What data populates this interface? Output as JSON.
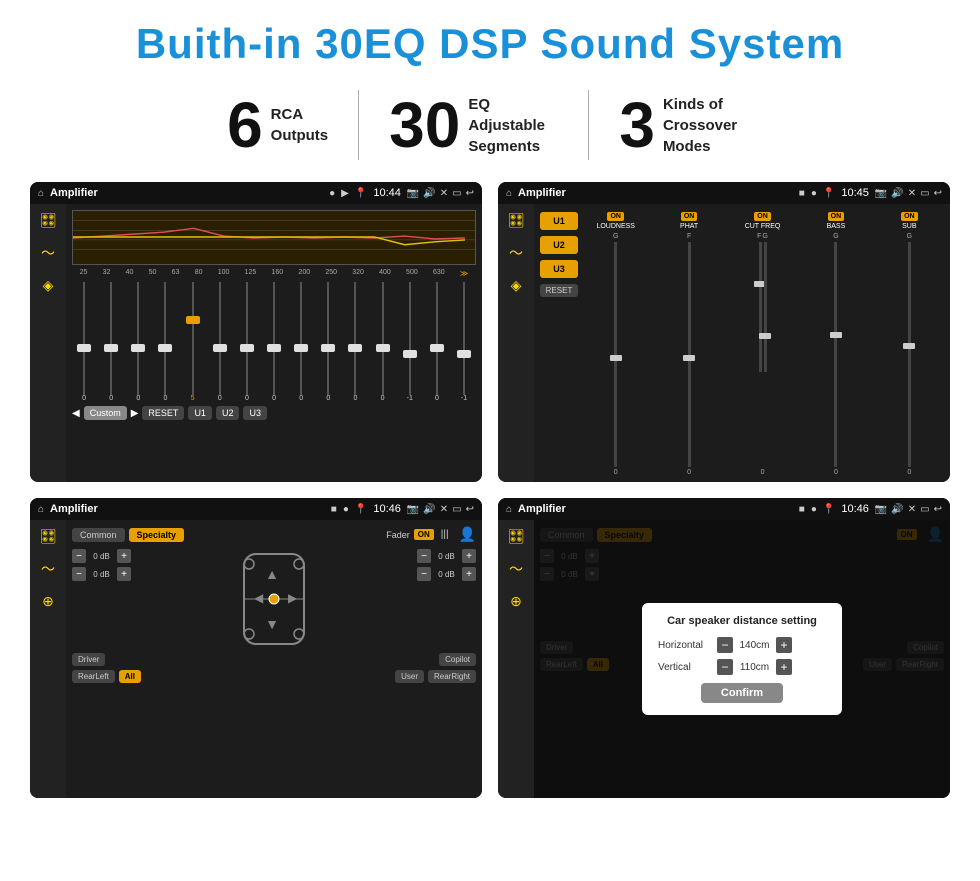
{
  "title": "Buith-in 30EQ DSP Sound System",
  "features": [
    {
      "number": "6",
      "desc_line1": "RCA",
      "desc_line2": "Outputs"
    },
    {
      "number": "30",
      "desc_line1": "EQ Adjustable",
      "desc_line2": "Segments"
    },
    {
      "number": "3",
      "desc_line1": "Kinds of",
      "desc_line2": "Crossover Modes"
    }
  ],
  "screens": [
    {
      "id": "screen1",
      "statusbar": {
        "title": "Amplifier",
        "time": "10:44"
      },
      "type": "eq"
    },
    {
      "id": "screen2",
      "statusbar": {
        "title": "Amplifier",
        "time": "10:45"
      },
      "type": "amp2"
    },
    {
      "id": "screen3",
      "statusbar": {
        "title": "Amplifier",
        "time": "10:46"
      },
      "type": "common"
    },
    {
      "id": "screen4",
      "statusbar": {
        "title": "Amplifier",
        "time": "10:46"
      },
      "type": "dialog"
    }
  ],
  "eq": {
    "freqs": [
      "25",
      "32",
      "40",
      "50",
      "63",
      "80",
      "100",
      "125",
      "160",
      "200",
      "250",
      "320",
      "400",
      "500",
      "630"
    ],
    "values": [
      "0",
      "0",
      "0",
      "0",
      "5",
      "0",
      "0",
      "0",
      "0",
      "0",
      "0",
      "0",
      "-1",
      "0",
      "-1"
    ],
    "buttons": [
      "Custom",
      "RESET",
      "U1",
      "U2",
      "U3"
    ]
  },
  "amp2": {
    "u_buttons": [
      "U1",
      "U2",
      "U3"
    ],
    "channels": [
      {
        "name": "LOUDNESS",
        "on": true,
        "g": "G",
        "f": ""
      },
      {
        "name": "PHAT",
        "on": true,
        "g": "",
        "f": "F"
      },
      {
        "name": "CUT FREQ",
        "on": true,
        "g": "G",
        "f": "F"
      },
      {
        "name": "BASS",
        "on": true,
        "g": "G",
        "f": ""
      },
      {
        "name": "SUB",
        "on": true,
        "g": "G",
        "f": ""
      }
    ],
    "reset": "RESET"
  },
  "common": {
    "tabs": [
      "Common",
      "Specialty"
    ],
    "fader_label": "Fader",
    "on": "ON",
    "db_values": [
      "0 dB",
      "0 dB",
      "0 dB",
      "0 dB"
    ],
    "floor_buttons": [
      "Driver",
      "Copilot",
      "RearLeft",
      "All",
      "User",
      "RearRight"
    ]
  },
  "dialog": {
    "title": "Car speaker distance setting",
    "horizontal_label": "Horizontal",
    "horizontal_value": "140cm",
    "vertical_label": "Vertical",
    "vertical_value": "110cm",
    "confirm": "Confirm",
    "tabs": [
      "Common",
      "Specialty"
    ],
    "on": "ON"
  },
  "colors": {
    "accent": "#e8a000",
    "blue_title": "#1a90d9",
    "screen_bg": "#1a1a1a",
    "status_bg": "#111"
  }
}
